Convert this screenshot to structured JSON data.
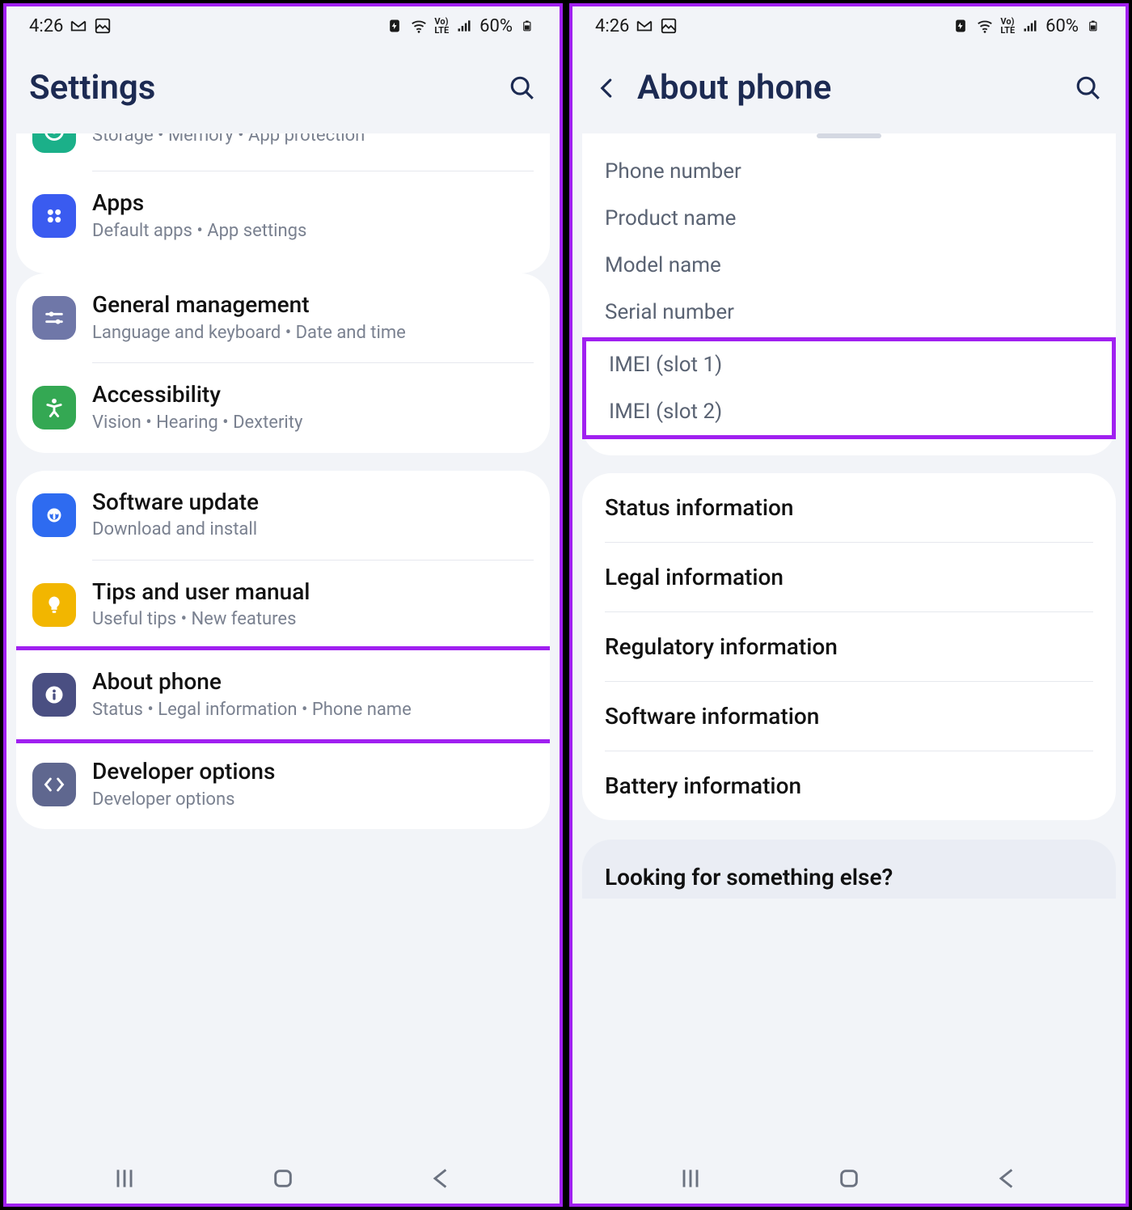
{
  "statusbar": {
    "time": "4:26",
    "battery_text": "60%"
  },
  "left": {
    "title": "Settings",
    "partial_sub": "Storage  •  Memory  •  App protection",
    "groups": [
      {
        "items": [
          {
            "title": "Apps",
            "sub": "Default apps  •  App settings",
            "icon_bg": "#3a5bf0",
            "icon": "apps"
          }
        ]
      },
      {
        "items": [
          {
            "title": "General management",
            "sub": "Language and keyboard  •  Date and time",
            "icon_bg": "#6f77a8",
            "icon": "sliders"
          },
          {
            "title": "Accessibility",
            "sub": "Vision  •  Hearing  •  Dexterity",
            "icon_bg": "#34a853",
            "icon": "accessibility"
          }
        ]
      },
      {
        "items": [
          {
            "title": "Software update",
            "sub": "Download and install",
            "icon_bg": "#2e6bf0",
            "icon": "update"
          },
          {
            "title": "Tips and user manual",
            "sub": "Useful tips  •  New features",
            "icon_bg": "#f2b600",
            "icon": "tip"
          },
          {
            "title": "About phone",
            "sub": "Status  •  Legal information  •  Phone name",
            "icon_bg": "#4a4f82",
            "icon": "info",
            "highlight": true
          },
          {
            "title": "Developer options",
            "sub": "Developer options",
            "icon_bg": "#5f678f",
            "icon": "dev"
          }
        ]
      }
    ]
  },
  "right": {
    "title": "About phone",
    "info": {
      "phone_number": "Phone number",
      "product_name": "Product name",
      "model_name": "Model name",
      "serial_number": "Serial number",
      "imei1": "IMEI (slot 1)",
      "imei2": "IMEI (slot 2)"
    },
    "list": [
      "Status information",
      "Legal information",
      "Regulatory information",
      "Software information",
      "Battery information"
    ],
    "footer": "Looking for something else?"
  }
}
